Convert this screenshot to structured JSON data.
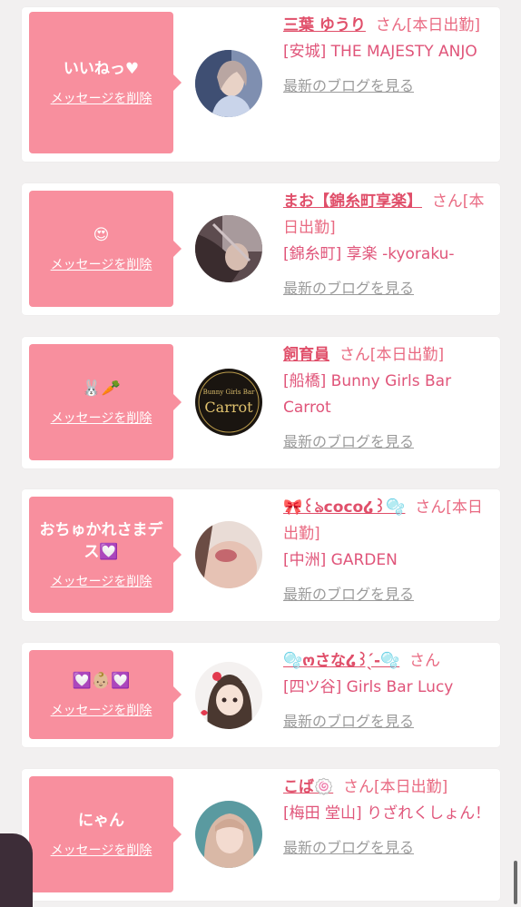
{
  "messages": [
    {
      "message": "いいねっ♥",
      "delete_label": "メッセージを削除",
      "name": "三葉 ゆうり",
      "suffix": "さん[本日出勤]",
      "shop": "[安城] THE MAJESTY ANJO",
      "blog_link": "最新のブログを見る",
      "avatar_icon": "woman-photo-avatar"
    },
    {
      "message": "😍",
      "delete_label": "メッセージを削除",
      "name": "まお【錦糸町享楽】",
      "suffix": "さん[本日出勤]",
      "shop": "[錦糸町] 享楽 -kyoraku-",
      "blog_link": "最新のブログを見る",
      "avatar_icon": "woman-photo-avatar"
    },
    {
      "message": "🐰🥕",
      "delete_label": "メッセージを削除",
      "name": "飼育員",
      "suffix": "さん[本日出勤]",
      "shop": "[船橋] Bunny Girls Bar Carrot",
      "blog_link": "最新のブログを見る",
      "avatar_icon": "bunny-girls-bar-logo",
      "avatar_logo_top": "Bunny Girls Bar",
      "avatar_logo_main": "Carrot"
    },
    {
      "message": "おちゅかれさまデス💟",
      "delete_label": "メッセージを削除",
      "name": "🎀꒰ঌcoco໒꒱🫧",
      "suffix": "さん[本日出勤]",
      "shop": "[中洲] GARDEN",
      "blog_link": "最新のブログを見る",
      "avatar_icon": "woman-photo-avatar"
    },
    {
      "message": "💟👶🏼💟",
      "delete_label": "メッセージを削除",
      "name": "🫧ოさな໒꒱ ̖́-🫧",
      "suffix": "さん",
      "shop": "[四ツ谷] Girls Bar Lucy",
      "blog_link": "最新のブログを見る",
      "avatar_icon": "anime-girl-avatar"
    },
    {
      "message": "にゃん",
      "delete_label": "メッセージを削除",
      "name": "こば🍥",
      "suffix": "さん[本日出勤]",
      "shop": "[梅田 堂山] りざれくしょん！",
      "blog_link": "最新のブログを見る",
      "avatar_icon": "woman-photo-avatar"
    }
  ],
  "colors": {
    "bubble": "#f88f9e",
    "name": "#e04f6a",
    "link_gray": "#9b9b9b",
    "background": "#f2f0f0"
  }
}
